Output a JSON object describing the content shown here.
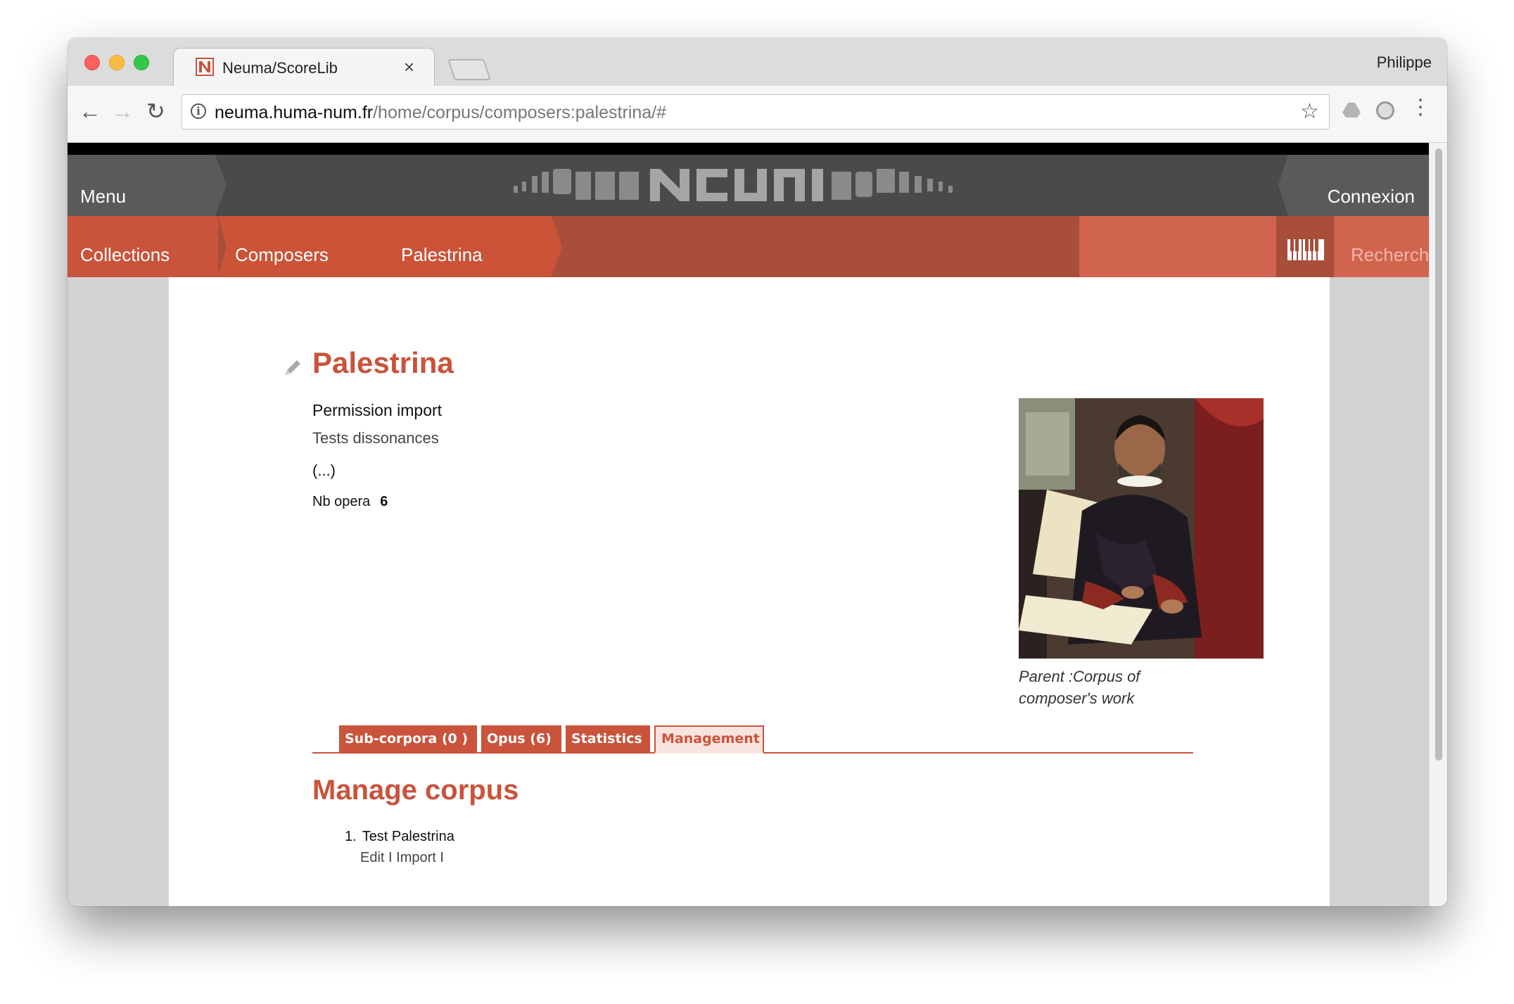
{
  "browser": {
    "tab_title": "Neuma/ScoreLib",
    "tab_close": "×",
    "profile_name": "Philippe",
    "url_host": "neuma.huma-num.fr",
    "url_path": "/home/corpus/composers:palestrina/#",
    "icons": [
      "back-arrow-icon",
      "forward-arrow-icon",
      "reload-icon",
      "info-icon",
      "star-icon",
      "drive-icon",
      "ghostery-icon",
      "kebab-menu-icon"
    ]
  },
  "header": {
    "menu_label": "Menu",
    "connexion_label": "Connexion",
    "logo_name": "neuma-logo"
  },
  "nav": {
    "crumbs": [
      "Collections",
      "Composers",
      "Palestrina"
    ],
    "search_label": "Recherche",
    "piano_icon": "piano-keys-icon"
  },
  "corpus": {
    "title": "Palestrina",
    "permission_text": "Permission import",
    "description": "Tests dissonances",
    "ellipsis": "(...)",
    "nb_opera_label": "Nb opera",
    "nb_opera_value": "6",
    "caption": "Parent :Corpus of composer's work"
  },
  "tabs": [
    "Sub-corpora (0 )",
    "Opus (6)",
    "Statistics",
    "Management"
  ],
  "active_tab": "Management",
  "management": {
    "title": "Manage corpus",
    "item_number": "1.",
    "item_name": "Test Palestrina",
    "actions": "Edit I Import I"
  },
  "colors": {
    "accent": "#c9533b",
    "header_dark": "#4a4a4a",
    "redbar": "#a84e3a",
    "search_block": "#d0644f"
  }
}
